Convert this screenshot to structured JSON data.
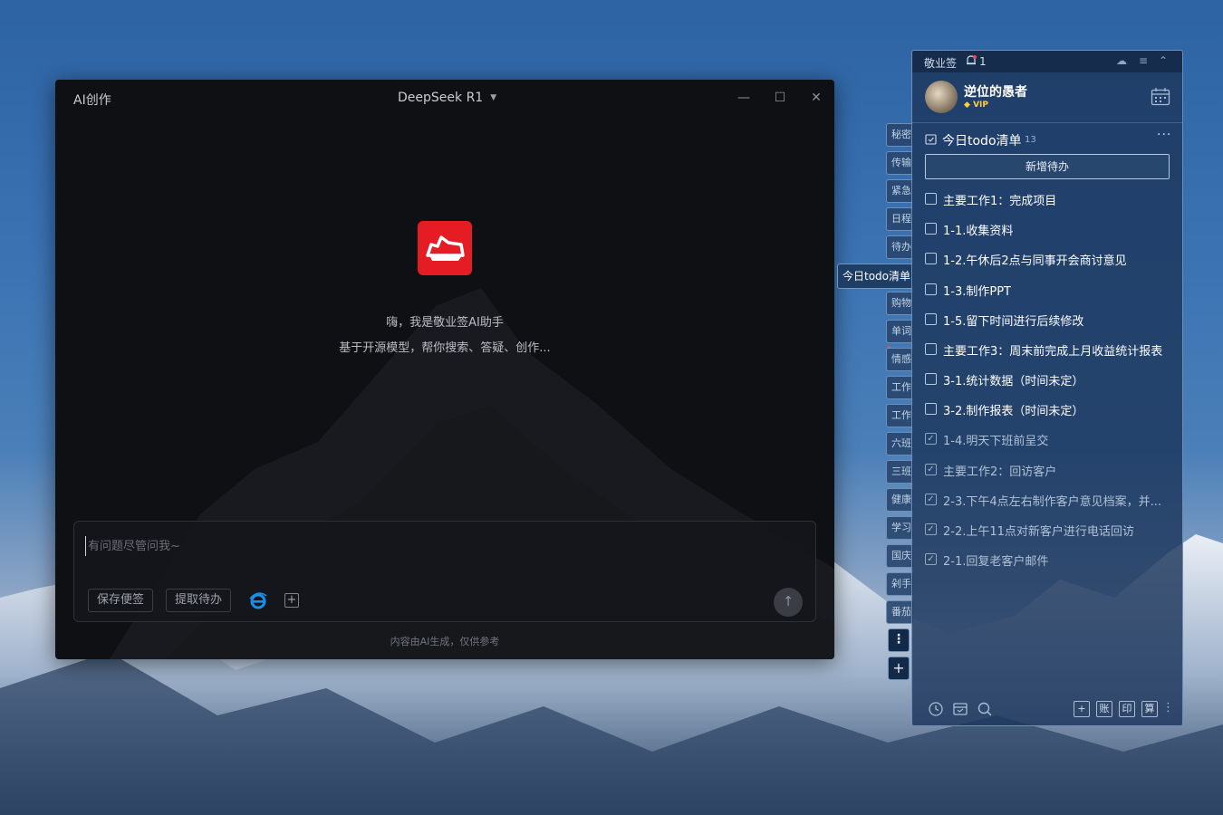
{
  "ai_window": {
    "title": "AI创作",
    "model": "DeepSeek R1",
    "greeting_line1": "嗨，我是敬业签AI助手",
    "greeting_line2": "基于开源模型，帮你搜索、答疑、创作...",
    "input_placeholder": "有问题尽管问我~",
    "btn_save_note": "保存便签",
    "btn_extract_todo": "提取待办",
    "disclaimer": "内容由AI生成，仅供参考"
  },
  "side_tabs": {
    "items": [
      "秘密",
      "传输",
      "紧急",
      "日程",
      "待办",
      "购物",
      "单词",
      "情感",
      "工作",
      "工作",
      "六班",
      "三班",
      "健康",
      "学习",
      "国庆",
      "剁手",
      "番茄"
    ],
    "active": "今日todo清单"
  },
  "note": {
    "app_name": "敬业签",
    "bell_count": "1",
    "user_name": "逆位的愚者",
    "vip": "VIP",
    "list_title": "今日todo清单",
    "list_count": "13",
    "list_more": "···",
    "add_todo": "新增待办",
    "todos": [
      {
        "text": "主要工作1：完成项目",
        "done": false
      },
      {
        "text": "1-1.收集资料",
        "done": false
      },
      {
        "text": "1-2.午休后2点与同事开会商讨意见",
        "done": false
      },
      {
        "text": "1-3.制作PPT",
        "done": false
      },
      {
        "text": "1-5.留下时间进行后续修改",
        "done": false
      },
      {
        "text": "主要工作3：周末前完成上月收益统计报表",
        "done": false
      },
      {
        "text": "3-1.统计数据（时间未定）",
        "done": false
      },
      {
        "text": "3-2.制作报表（时间未定）",
        "done": false
      },
      {
        "text": "1-4.明天下班前呈交",
        "done": true
      },
      {
        "text": "主要工作2：回访客户",
        "done": true
      },
      {
        "text": "2-3.下午4点左右制作客户意见档案，并...",
        "done": true
      },
      {
        "text": "2-2.上午11点对新客户进行电话回访",
        "done": true
      },
      {
        "text": "2-1.回复老客户邮件",
        "done": true
      }
    ],
    "footer_buttons": [
      "账",
      "印",
      "算"
    ]
  }
}
